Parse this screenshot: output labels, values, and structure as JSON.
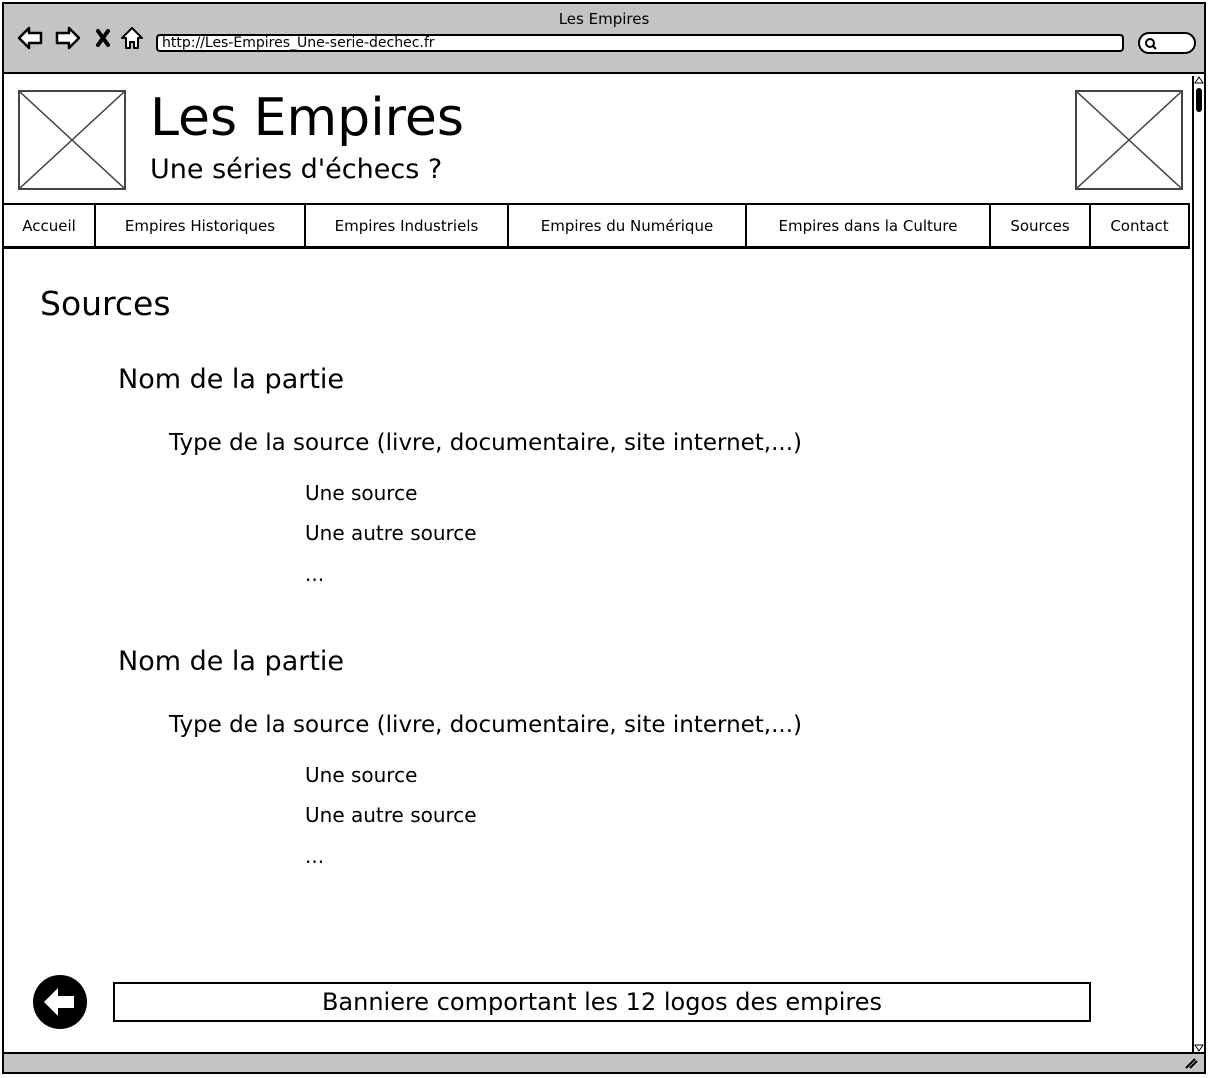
{
  "window": {
    "title": "Les Empires"
  },
  "browser": {
    "url": "http://Les-Empires_Une-serie-dechec.fr"
  },
  "header": {
    "title": "Les Empires",
    "subtitle": "Une séries d'échecs ?"
  },
  "nav": {
    "items": [
      {
        "label": "Accueil"
      },
      {
        "label": "Empires Historiques"
      },
      {
        "label": "Empires Industriels"
      },
      {
        "label": "Empires du Numérique"
      },
      {
        "label": "Empires dans la Culture"
      },
      {
        "label": "Sources"
      },
      {
        "label": "Contact"
      }
    ]
  },
  "main": {
    "heading": "Sources",
    "sections": [
      {
        "part": "Nom de la partie",
        "type": "Type de la source (livre, documentaire, site internet,...)",
        "sources": [
          "Une source",
          "Une autre source",
          "..."
        ]
      },
      {
        "part": "Nom de la partie",
        "type": "Type de la source (livre, documentaire, site internet,...)",
        "sources": [
          "Une source",
          "Une autre source",
          "..."
        ]
      }
    ]
  },
  "footer": {
    "banner": "Banniere comportant les 12 logos des empires"
  },
  "icons": [
    "back-icon",
    "forward-icon",
    "close-icon",
    "home-icon",
    "search-icon",
    "placeholder-image-icon",
    "back-arrow-icon"
  ]
}
